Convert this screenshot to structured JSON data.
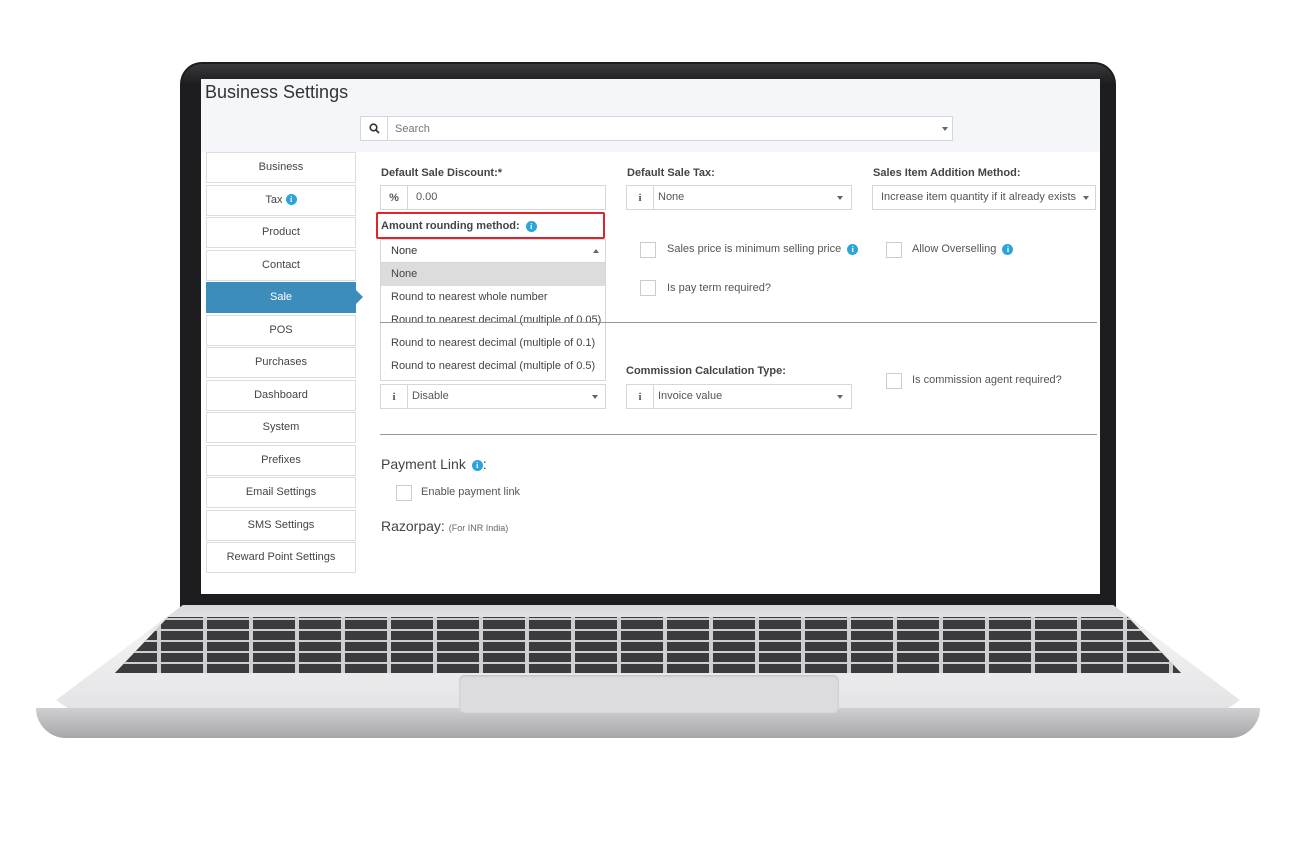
{
  "app": {
    "title": "Business Settings"
  },
  "search": {
    "placeholder": "Search"
  },
  "sidebar": {
    "items": [
      {
        "label": "Business"
      },
      {
        "label": "Tax"
      },
      {
        "label": "Product"
      },
      {
        "label": "Contact"
      },
      {
        "label": "Sale"
      },
      {
        "label": "POS"
      },
      {
        "label": "Purchases"
      },
      {
        "label": "Dashboard"
      },
      {
        "label": "System"
      },
      {
        "label": "Prefixes"
      },
      {
        "label": "Email Settings"
      },
      {
        "label": "SMS Settings"
      },
      {
        "label": "Reward Point Settings"
      }
    ]
  },
  "form": {
    "default_sale_discount": {
      "label": "Default Sale Discount:*",
      "addon": "%",
      "value": "0.00"
    },
    "default_sale_tax": {
      "label": "Default Sale Tax:",
      "addon": "i",
      "value": "None"
    },
    "sales_item_addition": {
      "label": "Sales Item Addition Method:",
      "value": "Increase item quantity if it already exists"
    },
    "amount_rounding": {
      "label": "Amount rounding method:",
      "selected": "None",
      "options": [
        "None",
        "Round to nearest whole number",
        "Round to nearest decimal (multiple of 0.05)",
        "Round to nearest decimal (multiple of 0.1)",
        "Round to nearest decimal (multiple of 0.5)"
      ]
    },
    "sales_price_min": {
      "label": "Sales price is minimum selling price"
    },
    "allow_overselling": {
      "label": "Allow Overselling"
    },
    "pay_term_required": {
      "label": "Is pay term required?"
    },
    "commission_agent": {
      "addon": "i",
      "value": "Disable"
    },
    "commission_calc": {
      "label": "Commission Calculation Type:",
      "addon": "i",
      "value": "Invoice value"
    },
    "commission_required": {
      "label": "Is commission agent required?"
    },
    "payment_link": {
      "title": "Payment Link",
      "colon": ":",
      "enable_label": "Enable payment link"
    },
    "razorpay": {
      "title": "Razorpay:",
      "note": "(For INR India)"
    }
  },
  "colors": {
    "accent": "#3c8dbc",
    "info": "#2ba4d9",
    "highlight": "#e0242c"
  }
}
